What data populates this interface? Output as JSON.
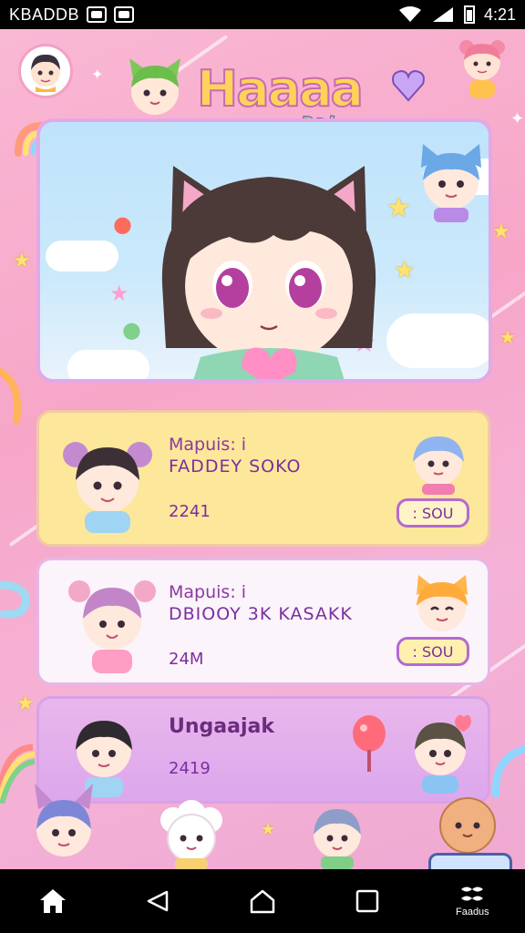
{
  "status_bar": {
    "carrier": "KBADDB",
    "time": "4:21"
  },
  "header": {
    "logo_title": "Haaaa",
    "logo_subtitle": "aaks"
  },
  "cards": [
    {
      "label": "Mapuis: i",
      "title": "FADDEY SOKO",
      "count": "2241",
      "button": ": SOU"
    },
    {
      "label": "Mapuis: i",
      "title": "DBIOOY 3K KASAKK",
      "count": "24M",
      "button": ": SOU"
    },
    {
      "title": "Ungaajak",
      "count": "2419"
    }
  ],
  "nav": {
    "home_icon": "home-icon",
    "back_icon": "back-icon",
    "home2_icon": "house-icon",
    "recent_icon": "square-icon",
    "more_label": "Faadus"
  },
  "colors": {
    "background": "#f7a6c8",
    "card_yellow": "#fde79a",
    "card_white": "#fbf4fb",
    "card_purple": "#e9b6ec",
    "accent": "#7b2f9e"
  }
}
